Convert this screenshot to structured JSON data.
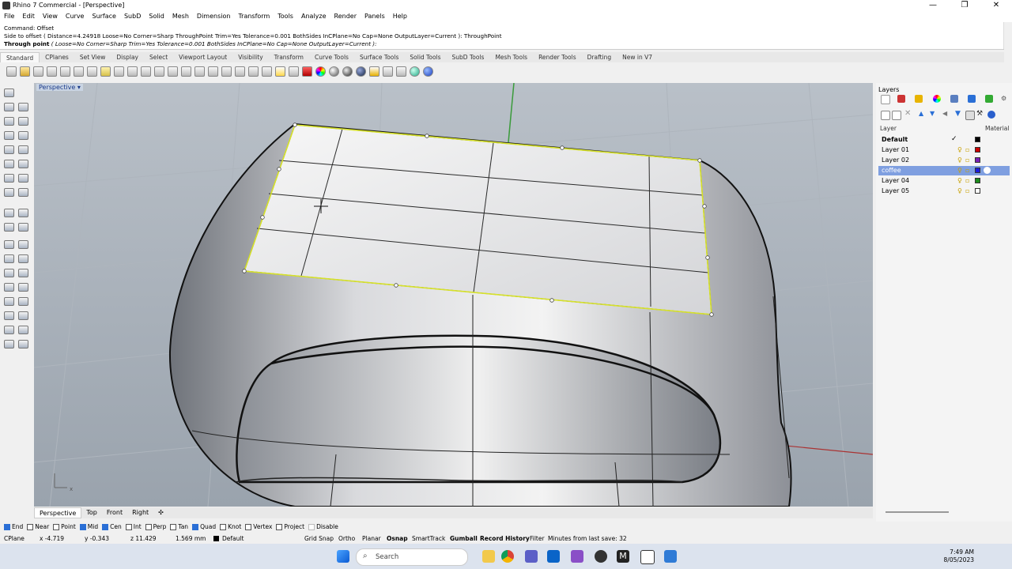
{
  "window": {
    "title": "Rhino 7 Commercial - [Perspective]",
    "controls": [
      "—",
      "❐",
      "✕"
    ]
  },
  "menu": [
    "File",
    "Edit",
    "View",
    "Curve",
    "Surface",
    "SubD",
    "Solid",
    "Mesh",
    "Dimension",
    "Transform",
    "Tools",
    "Analyze",
    "Render",
    "Panels",
    "Help"
  ],
  "command": {
    "line1": "Command: Offset",
    "line2": "Side to offset ( Distance=4.24918  Loose=No  Corner=Sharp  ThroughPoint  Trim=Yes  Tolerance=0.001  BothSides  InCPlane=No  Cap=None  OutputLayer=Current ): ThroughPoint",
    "prompt_label": "Through point",
    "prompt_options": " ( Loose=No  Corner=Sharp  Trim=Yes  Tolerance=0.001  BothSides  InCPlane=No  Cap=None  OutputLayer=Current ):"
  },
  "toolbar_tabs": [
    "Standard",
    "CPlanes",
    "Set View",
    "Display",
    "Select",
    "Viewport Layout",
    "Visibility",
    "Transform",
    "Curve Tools",
    "Surface Tools",
    "Solid Tools",
    "SubD Tools",
    "Mesh Tools",
    "Render Tools",
    "Drafting",
    "New in V7"
  ],
  "viewport": {
    "label": "Perspective",
    "axis_x": "x"
  },
  "viewport_tabs": [
    "Perspective",
    "Top",
    "Front",
    "Right",
    "✣"
  ],
  "osnaps": [
    {
      "label": "End",
      "on": true
    },
    {
      "label": "Near",
      "on": false
    },
    {
      "label": "Point",
      "on": false
    },
    {
      "label": "Mid",
      "on": true
    },
    {
      "label": "Cen",
      "on": true
    },
    {
      "label": "Int",
      "on": false
    },
    {
      "label": "Perp",
      "on": false
    },
    {
      "label": "Tan",
      "on": false
    },
    {
      "label": "Quad",
      "on": true
    },
    {
      "label": "Knot",
      "on": false
    },
    {
      "label": "Vertex",
      "on": false
    },
    {
      "label": "Project",
      "on": false
    },
    {
      "label": "Disable",
      "on": false
    }
  ],
  "status": {
    "cplane": "CPlane",
    "x": "x -4.719",
    "y": "y -0.343",
    "z": "z 11.429",
    "unit": "1.569 mm",
    "layer": "Default",
    "toggles": [
      "Grid Snap",
      "Ortho",
      "Planar",
      "Osnap",
      "SmartTrack",
      "Gumball",
      "Record History",
      "Filter"
    ],
    "save": "Minutes from last save: 32"
  },
  "layers_panel": {
    "title": "Layers",
    "columns": {
      "layer": "Layer",
      "material": "Material"
    },
    "rows": [
      {
        "name": "Default",
        "color": "#000000",
        "current": true,
        "bold": true
      },
      {
        "name": "Layer 01",
        "color": "#cc0000"
      },
      {
        "name": "Layer 02",
        "color": "#7a1fb5"
      },
      {
        "name": "coffee",
        "color": "#1a1adb",
        "selected": true
      },
      {
        "name": "Layer 04",
        "color": "#1c8c1c"
      },
      {
        "name": "Layer 05",
        "color": "#ffffff"
      }
    ],
    "check": "✓"
  },
  "taskbar": {
    "search": "Search",
    "time": "7:49 AM",
    "date": "8/05/2023"
  }
}
